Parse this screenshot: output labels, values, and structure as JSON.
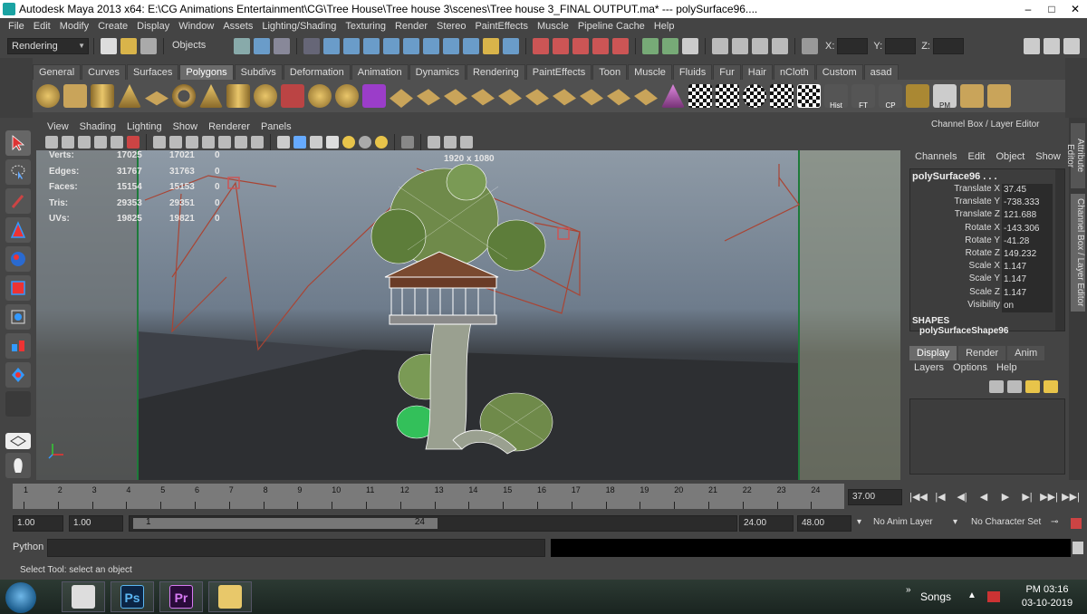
{
  "window": {
    "title": "Autodesk Maya 2013 x64: E:\\CG Animations Entertainment\\CG\\Tree House\\Tree house 3\\scenes\\Tree house 3_FINAL OUTPUT.ma*   ---   polySurface96....",
    "controls": [
      "–",
      "□",
      "✕"
    ]
  },
  "menubar": [
    "File",
    "Edit",
    "Modify",
    "Create",
    "Display",
    "Window",
    "Assets",
    "Lighting/Shading",
    "Texturing",
    "Render",
    "Stereo",
    "PaintEffects",
    "Muscle",
    "Pipeline Cache",
    "Help"
  ],
  "statusline": {
    "menuset": "Rendering",
    "selection_mode": "Objects",
    "x_label": "X:",
    "y_label": "Y:",
    "z_label": "Z:"
  },
  "shelf": {
    "tabs": [
      "General",
      "Curves",
      "Surfaces",
      "Polygons",
      "Subdivs",
      "Deformation",
      "Animation",
      "Dynamics",
      "Rendering",
      "PaintEffects",
      "Toon",
      "Muscle",
      "Fluids",
      "Fur",
      "Hair",
      "nCloth",
      "Custom",
      "asad"
    ],
    "active_tab": "Polygons",
    "icon_labels": [
      "Hist",
      "FT",
      "CP",
      "PM"
    ]
  },
  "viewport": {
    "menu": [
      "View",
      "Shading",
      "Lighting",
      "Show",
      "Renderer",
      "Panels"
    ],
    "hud": [
      {
        "label": "Verts:",
        "v1": "17025",
        "v2": "17021",
        "v3": "0"
      },
      {
        "label": "Edges:",
        "v1": "31767",
        "v2": "31763",
        "v3": "0"
      },
      {
        "label": "Faces:",
        "v1": "15154",
        "v2": "15153",
        "v3": "0"
      },
      {
        "label": "Tris:",
        "v1": "29353",
        "v2": "29351",
        "v3": "0"
      },
      {
        "label": "UVs:",
        "v1": "19825",
        "v2": "19821",
        "v3": "0"
      }
    ],
    "resolution": "1920 x 1080"
  },
  "channel_box": {
    "title": "Channel Box / Layer Editor",
    "menu": [
      "Channels",
      "Edit",
      "Object",
      "Show"
    ],
    "object": "polySurface96 . . .",
    "attributes": [
      {
        "name": "Translate X",
        "value": "37.45"
      },
      {
        "name": "Translate Y",
        "value": "-738.333"
      },
      {
        "name": "Translate Z",
        "value": "121.688"
      },
      {
        "name": "Rotate X",
        "value": "-143.306"
      },
      {
        "name": "Rotate Y",
        "value": "-41.28"
      },
      {
        "name": "Rotate Z",
        "value": "149.232"
      },
      {
        "name": "Scale X",
        "value": "1.147"
      },
      {
        "name": "Scale Y",
        "value": "1.147"
      },
      {
        "name": "Scale Z",
        "value": "1.147"
      },
      {
        "name": "Visibility",
        "value": "on"
      }
    ],
    "shapes_label": "SHAPES",
    "shape_name": "polySurfaceShape96",
    "side_tabs": [
      "Attribute Editor",
      "Channel Box / Layer Editor"
    ]
  },
  "layer_editor": {
    "tabs": [
      "Display",
      "Render",
      "Anim"
    ],
    "active_tab": "Display",
    "menu": [
      "Layers",
      "Options",
      "Help"
    ]
  },
  "timeline": {
    "ticks": [
      "1",
      "2",
      "3",
      "4",
      "5",
      "6",
      "7",
      "8",
      "9",
      "10",
      "11",
      "12",
      "13",
      "14",
      "15",
      "16",
      "17",
      "18",
      "19",
      "20",
      "21",
      "22",
      "23",
      "24"
    ],
    "current_frame": "37.00",
    "playback": [
      "|◀◀",
      "|◀",
      "◀|",
      "◀",
      "▶",
      "▶|",
      "▶▶|",
      "▶▶|"
    ]
  },
  "range": {
    "start": "1.00",
    "playback_start": "1.00",
    "slider_start": "1",
    "slider_end": "24",
    "playback_end": "24.00",
    "end": "48.00",
    "anim_layer": "No Anim Layer",
    "character_set": "No Character Set"
  },
  "command_line": {
    "label": "Python"
  },
  "help_line": "Select Tool: select an object",
  "taskbar": {
    "apps": [
      "Maya",
      "Ps",
      "Pr",
      "Explorer"
    ],
    "tray_songs": "Songs",
    "time": "PM 03:16",
    "date": "03-10-2019"
  }
}
